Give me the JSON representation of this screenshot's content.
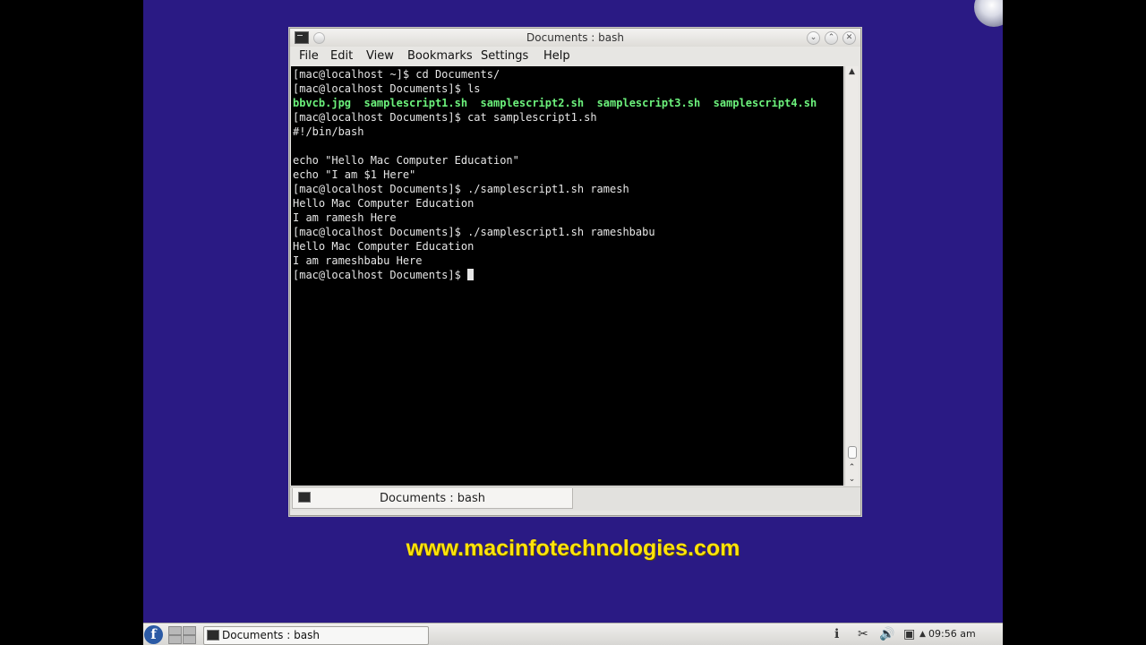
{
  "window": {
    "title": "Documents : bash",
    "menu": [
      "File",
      "Edit",
      "View",
      "Bookmarks",
      "Settings",
      "Help"
    ]
  },
  "terminal": {
    "lines": [
      {
        "type": "text",
        "text": "[mac@localhost ~]$ cd Documents/"
      },
      {
        "type": "text",
        "text": "[mac@localhost Documents]$ ls"
      },
      {
        "type": "ls",
        "files": [
          "bbvcb.jpg",
          "samplescript1.sh",
          "samplescript2.sh",
          "samplescript3.sh",
          "samplescript4.sh"
        ]
      },
      {
        "type": "text",
        "text": "[mac@localhost Documents]$ cat samplescript1.sh"
      },
      {
        "type": "text",
        "text": "#!/bin/bash"
      },
      {
        "type": "text",
        "text": ""
      },
      {
        "type": "text",
        "text": "echo \"Hello Mac Computer Education\""
      },
      {
        "type": "text",
        "text": "echo \"I am $1 Here\""
      },
      {
        "type": "text",
        "text": "[mac@localhost Documents]$ ./samplescript1.sh ramesh"
      },
      {
        "type": "text",
        "text": "Hello Mac Computer Education"
      },
      {
        "type": "text",
        "text": "I am ramesh Here"
      },
      {
        "type": "text",
        "text": "[mac@localhost Documents]$ ./samplescript1.sh rameshbabu"
      },
      {
        "type": "text",
        "text": "Hello Mac Computer Education"
      },
      {
        "type": "text",
        "text": "I am rameshbabu Here"
      },
      {
        "type": "prompt",
        "text": "[mac@localhost Documents]$ "
      }
    ],
    "colors": {
      "background": "#000000",
      "text": "#e6e6e6",
      "executable": "#6cf27c"
    }
  },
  "tab": {
    "label": "Documents : bash"
  },
  "watermark": {
    "text": "www.macinfotechnologies.com",
    "color": "#ffe30a"
  },
  "taskbar": {
    "task_label": "Documents : bash",
    "clock": "09:56 am",
    "tray_icons": [
      "info-icon",
      "scissors-icon",
      "volume-icon",
      "network-icon",
      "arrow-up-icon"
    ]
  },
  "desktop": {
    "background": "#2a1a84"
  }
}
